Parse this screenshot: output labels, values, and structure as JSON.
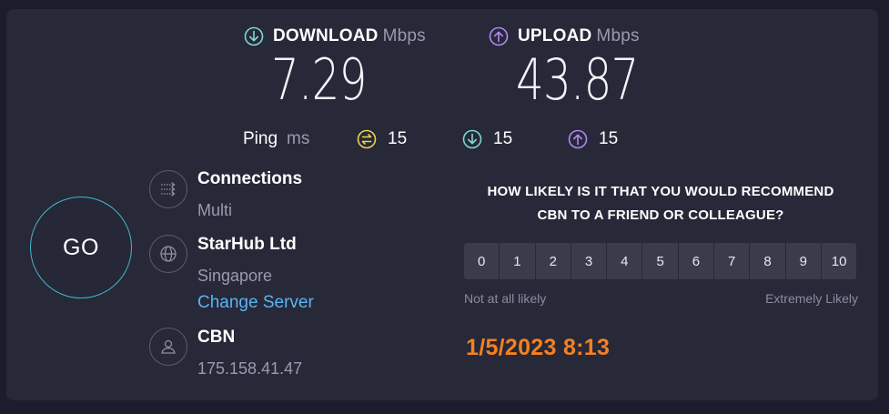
{
  "download": {
    "label": "DOWNLOAD",
    "unit": "Mbps",
    "value": "7.29",
    "color": "#7fd9d0"
  },
  "upload": {
    "label": "UPLOAD",
    "unit": "Mbps",
    "value": "43.87",
    "color": "#b488f0"
  },
  "ping": {
    "label": "Ping",
    "unit": "ms",
    "idle": "15",
    "download": "15",
    "upload": "15",
    "idle_color": "#e8d64a"
  },
  "go_label": "GO",
  "connections": {
    "title": "Connections",
    "value": "Multi"
  },
  "server": {
    "name": "StarHub Ltd",
    "location": "Singapore",
    "change_label": "Change Server"
  },
  "isp": {
    "name": "CBN",
    "ip": "175.158.41.47"
  },
  "survey": {
    "question_line1": "HOW LIKELY IS IT THAT YOU WOULD RECOMMEND",
    "question_line2": "CBN TO A FRIEND OR COLLEAGUE?",
    "options": [
      "0",
      "1",
      "2",
      "3",
      "4",
      "5",
      "6",
      "7",
      "8",
      "9",
      "10"
    ],
    "low_label": "Not at all likely",
    "high_label": "Extremely Likely"
  },
  "timestamp": "1/5/2023 8:13",
  "colors": {
    "accent_link": "#59b5f3",
    "timestamp": "#f58020",
    "go_ring": "#3fb9cc"
  }
}
